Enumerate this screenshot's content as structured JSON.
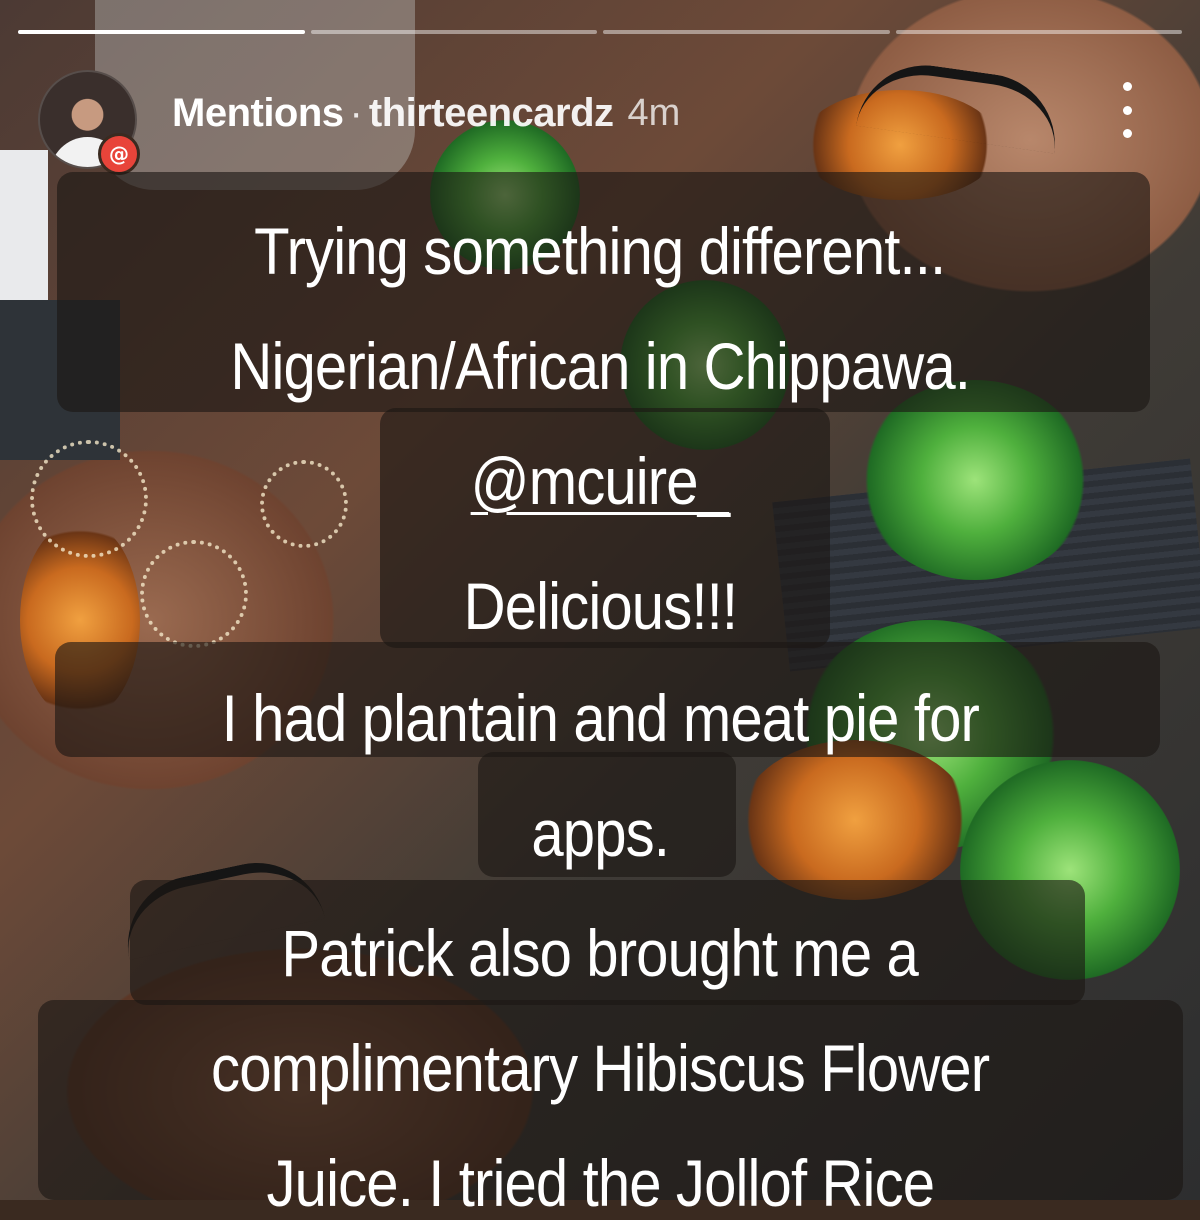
{
  "story": {
    "header": {
      "title": "Mentions",
      "separator": "·",
      "username": "thirteencardz",
      "time": "4m",
      "badge": "@"
    },
    "progress": {
      "segments": 4,
      "active_index": 0
    },
    "caption_lines": [
      "Trying something different...",
      "Nigerian/African in Chippawa.",
      "@mcuire_",
      "Delicious!!!",
      "I had plantain and meat pie for",
      "apps.",
      "Patrick also brought me a",
      "complimentary Hibiscus Flower",
      "Juice. I tried the Jollof Rice"
    ]
  }
}
